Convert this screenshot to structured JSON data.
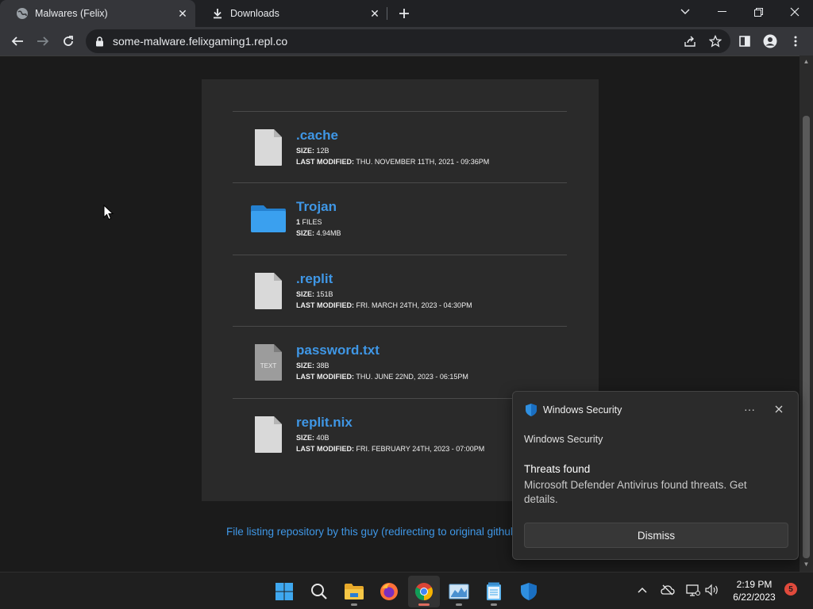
{
  "browser": {
    "tabs": [
      {
        "title": "Malwares (Felix)",
        "active": true
      },
      {
        "title": "Downloads",
        "active": false
      }
    ],
    "url": "some-malware.felixgaming1.repl.co"
  },
  "files": [
    {
      "name": ".cache",
      "type": "file",
      "line1_label": "SIZE:",
      "line1_value": "12B",
      "line2_label": "LAST MODIFIED:",
      "line2_value": "THU. NOVEMBER 11TH, 2021 - 09:36PM"
    },
    {
      "name": "Trojan",
      "type": "folder",
      "line1_label": "1",
      "line1_value": "FILES",
      "line2_label": "SIZE:",
      "line2_value": "4.94MB"
    },
    {
      "name": ".replit",
      "type": "file",
      "line1_label": "SIZE:",
      "line1_value": "151B",
      "line2_label": "LAST MODIFIED:",
      "line2_value": "FRI. MARCH 24TH, 2023 - 04:30PM"
    },
    {
      "name": "password.txt",
      "type": "text",
      "icon_label": "TEXT",
      "line1_label": "SIZE:",
      "line1_value": "38B",
      "line2_label": "LAST MODIFIED:",
      "line2_value": "THU. JUNE 22ND, 2023 - 06:15PM"
    },
    {
      "name": "replit.nix",
      "type": "file",
      "line1_label": "SIZE:",
      "line1_value": "40B",
      "line2_label": "LAST MODIFIED:",
      "line2_value": "FRI. FEBRUARY 24TH, 2023 - 07:00PM"
    }
  ],
  "footer": {
    "link_text": "File listing repository by this guy (redirecting to original github)"
  },
  "toast": {
    "app_name": "Windows Security",
    "subtitle": "Windows Security",
    "heading": "Threats found",
    "body": "Microsoft Defender Antivirus found threats. Get details.",
    "dismiss_label": "Dismiss"
  },
  "taskbar": {
    "time": "2:19 PM",
    "date": "6/22/2023",
    "notification_count": "5"
  },
  "colors": {
    "link": "#3f97e6",
    "folder": "#2e8fde",
    "accent_indicator": "#e06c5f"
  }
}
